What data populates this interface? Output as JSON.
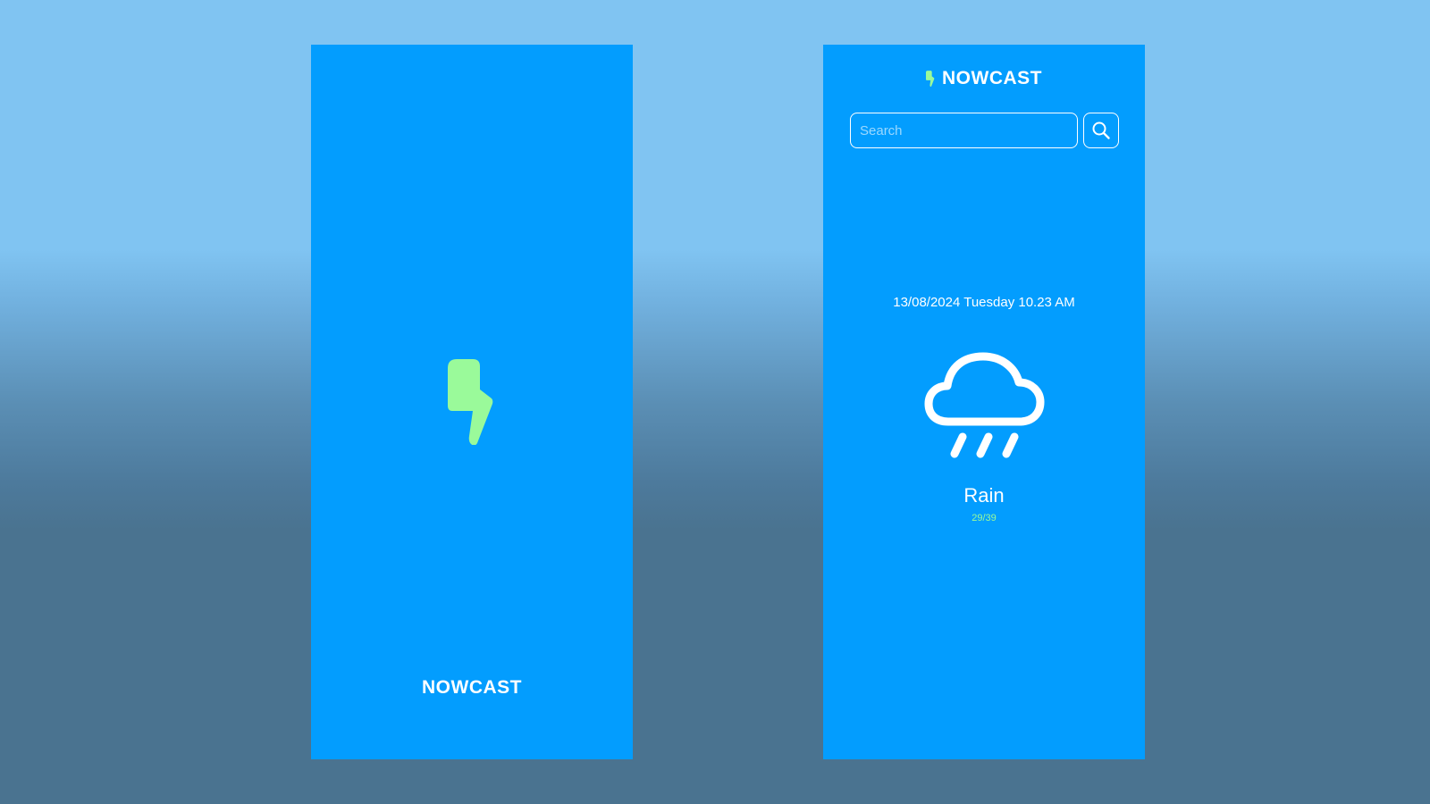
{
  "splash": {
    "logo_icon": "lightning-bolt-icon",
    "app_name": "NOWCAST"
  },
  "home": {
    "header": {
      "logo_icon": "lightning-bolt-icon",
      "app_name": "NOWCAST"
    },
    "search": {
      "placeholder": "Search",
      "button_icon": "search-icon"
    },
    "weather": {
      "datetime": "13/08/2024 Tuesday 10.23 AM",
      "icon": "cloud-rain-icon",
      "condition": "Rain",
      "temp_range": "29/39"
    }
  },
  "colors": {
    "phone_background": "#039dfe",
    "accent_green": "#9afa9a",
    "text": "#ffffff"
  }
}
